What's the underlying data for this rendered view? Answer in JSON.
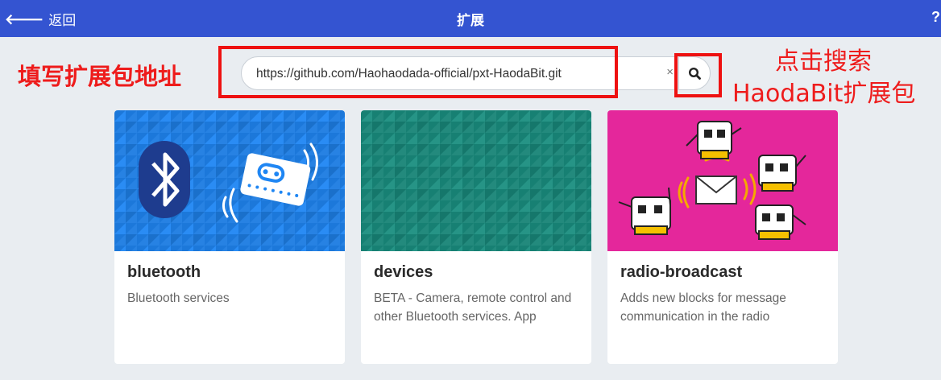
{
  "header": {
    "back_label": "返回",
    "title": "扩展",
    "help": "?"
  },
  "annotations": {
    "left": "填写扩展包地址",
    "right_line1": "点击搜索",
    "right_line2": "HaodaBit扩展包"
  },
  "search": {
    "value": "https://github.com/Haohaodada-official/pxt-HaodaBit.git",
    "clear_icon": "×"
  },
  "cards": [
    {
      "name": "bluetooth",
      "desc": "Bluetooth services",
      "color": "#1f86f3"
    },
    {
      "name": "devices",
      "desc": "BETA - Camera, remote control and other Bluetooth services. App",
      "color": "#1a8e80"
    },
    {
      "name": "radio-broadcast",
      "desc": "Adds new blocks for message communication in the radio",
      "color": "#e4279b"
    }
  ],
  "colors": {
    "header": "#3454d1",
    "annotation": "#ee1c1c",
    "background": "#e9edf1"
  }
}
